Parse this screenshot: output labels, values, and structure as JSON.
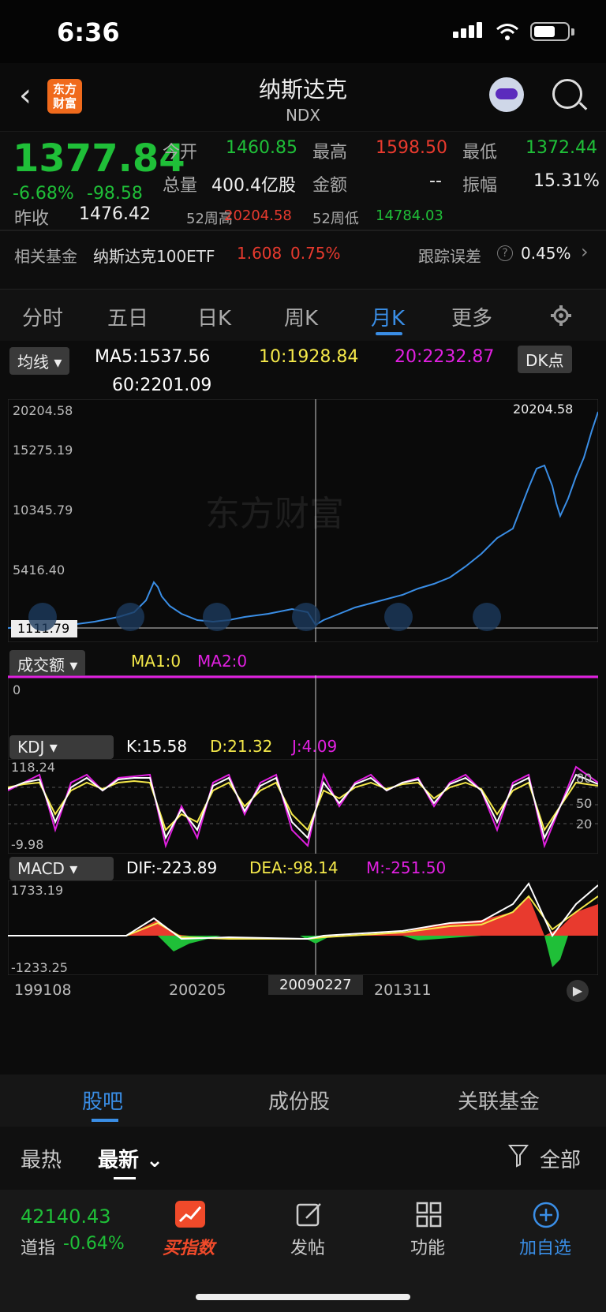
{
  "status": {
    "time": "6:36"
  },
  "header": {
    "title": "纳斯达克",
    "code": "NDX",
    "logo_text": "东方财富"
  },
  "quote": {
    "price": "1377.84",
    "pct": "-6.68%",
    "chg": "-98.58",
    "open_label": "今开",
    "open": "1460.85",
    "high_label": "最高",
    "high": "1598.50",
    "low_label": "最低",
    "low": "1372.44",
    "vol_label": "总量",
    "vol": "400.4亿股",
    "amt_label": "金额",
    "amt": "--",
    "amp_label": "振幅",
    "amp": "15.31%",
    "prev_label": "昨收",
    "prev": "1476.42",
    "w52h_label": "52周高",
    "w52h": "20204.58",
    "w52l_label": "52周低",
    "w52l": "14784.03",
    "fund_label": "相关基金",
    "fund_name": "纳斯达克100ETF",
    "fund_price": "1.608",
    "fund_pct": "0.75%",
    "track_label": "跟踪误差",
    "track_val": "0.45%"
  },
  "tabs": [
    {
      "label": "分时"
    },
    {
      "label": "五日"
    },
    {
      "label": "日K"
    },
    {
      "label": "周K"
    },
    {
      "label": "月K",
      "active": true
    },
    {
      "label": "更多"
    }
  ],
  "ma": {
    "sel": "均线",
    "ma5": "MA5:1537.56",
    "ma10": "10:1928.84",
    "ma20": "20:2232.87",
    "ma60": "60:2201.09",
    "dk": "DK点"
  },
  "price_chart": {
    "y1": "20204.58",
    "y2": "15275.19",
    "y3": "10345.79",
    "y4": "5416.40",
    "low": "1111.79",
    "high_mark": "20204.58",
    "watermark": "东方财富"
  },
  "vol": {
    "sel": "成交额",
    "ma1": "MA1:0",
    "ma2": "MA2:0",
    "zero": "0"
  },
  "kdj": {
    "sel": "KDJ",
    "k": "K:15.58",
    "d": "D:21.32",
    "j": "J:4.09",
    "top": "118.24",
    "bottom": "-9.98",
    "l80": "80",
    "l50": "50",
    "l20": "20"
  },
  "macd": {
    "sel": "MACD",
    "dif": "DIF:-223.89",
    "dea": "DEA:-98.14",
    "m": "M:-251.50",
    "top": "1733.19",
    "bottom": "-1233.25"
  },
  "xaxis": {
    "d1": "199108",
    "d2": "200205",
    "cursor": "20090227",
    "d3": "201311"
  },
  "bottom_tabs": [
    {
      "label": "股吧",
      "active": true
    },
    {
      "label": "成份股"
    },
    {
      "label": "关联基金"
    }
  ],
  "feed": {
    "hot": "最热",
    "new": "最新",
    "filter": "全部"
  },
  "dock": {
    "index_price": "42140.43",
    "index_name": "道指",
    "index_pct": "-0.64%",
    "buy": "买指数",
    "post": "发帖",
    "func": "功能",
    "add": "加自选"
  },
  "colors": {
    "up": "#e83a2e",
    "down": "#1fbf38",
    "accent": "#3a8ee6",
    "k": "#ffffff",
    "d": "#f5e94a",
    "j": "#e020e0"
  },
  "chart_data": {
    "type": "line",
    "title": "",
    "x": [
      "199108",
      "200205",
      "20090227",
      "201311"
    ],
    "series": [
      {
        "values": [
          450,
          4000,
          1112,
          3400,
          9000,
          16000,
          11000,
          20204.58
        ]
      }
    ],
    "ylim": [
      1111.79,
      20204.58
    ]
  }
}
